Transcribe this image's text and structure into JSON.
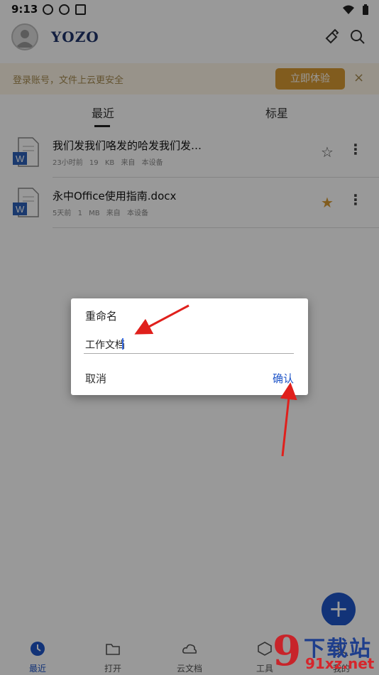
{
  "status": {
    "time": "9:13"
  },
  "app": {
    "logo": "YOZO"
  },
  "banner": {
    "text": "登录账号，文件上云更安全",
    "button": "立即体验",
    "close": "×"
  },
  "tabs": [
    {
      "label": "最近",
      "active": true
    },
    {
      "label": "标星",
      "active": false
    }
  ],
  "files": [
    {
      "name": "我们发我们咯发的哈发我们发…",
      "time": "23小时前",
      "size": "19 KB",
      "source": "来自 本设备",
      "starred": false
    },
    {
      "name": "永中Office使用指南.docx",
      "time": "5天前",
      "size": "1 MB",
      "source": "来自 本设备",
      "starred": true
    }
  ],
  "dialog": {
    "title": "重命名",
    "value": "工作文档",
    "cancel": "取消",
    "confirm": "确认"
  },
  "fab": "+",
  "nav": [
    {
      "label": "最近",
      "icon": "clock-icon"
    },
    {
      "label": "打开",
      "icon": "folder-icon"
    },
    {
      "label": "云文档",
      "icon": "cloud-icon"
    },
    {
      "label": "工具",
      "icon": "tools-icon"
    },
    {
      "label": "我的",
      "icon": "person-icon"
    }
  ],
  "watermark": {
    "big": "下载站",
    "small": "91xz.net",
    "mark": "9"
  },
  "colors": {
    "accent": "#1f55c8",
    "banner_button": "#d89a33",
    "star": "#d89a33",
    "arrow": "#e0201c"
  }
}
